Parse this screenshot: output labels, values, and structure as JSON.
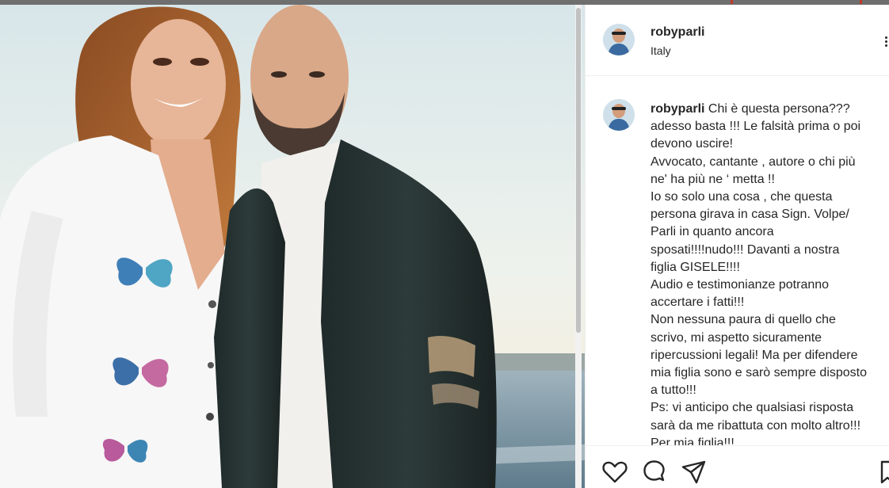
{
  "post": {
    "username": "robyparli",
    "location": "Italy",
    "caption": {
      "username": "robyparli",
      "lines": [
        "Chi è questa persona???",
        "adesso basta !!! Le falsità prima o poi",
        "devono uscire!",
        "Avvocato, cantante , autore o chi più",
        "ne' ha più ne ‘ metta !!",
        "Io so solo una cosa , che questa",
        "persona girava in casa Sign. Volpe/",
        "Parli in quanto ancora",
        "sposati!!!!nudo!!! Davanti a nostra",
        "figlia GISELE!!!!",
        "Audio e testimonianze potranno",
        "accertare i fatti!!!",
        "Non nessuna paura di quello che",
        "scrivo, mi aspetto sicuramente",
        "ripercussioni legali! Ma per difendere",
        "mia figlia sono e sarò sempre disposto",
        "a tutto!!!",
        "Ps: vi anticipo che qualsiasi risposta",
        "sarà da me ribattuta con molto altro!!!",
        "Per mia figlia!!!"
      ]
    }
  },
  "icons": {
    "more": "more-options-icon",
    "like": "heart-icon",
    "comment": "comment-icon",
    "share": "send-icon",
    "save": "bookmark-icon"
  },
  "colors": {
    "text": "#262626",
    "divider": "#efefef",
    "top_bar": "#6f6f6f"
  }
}
